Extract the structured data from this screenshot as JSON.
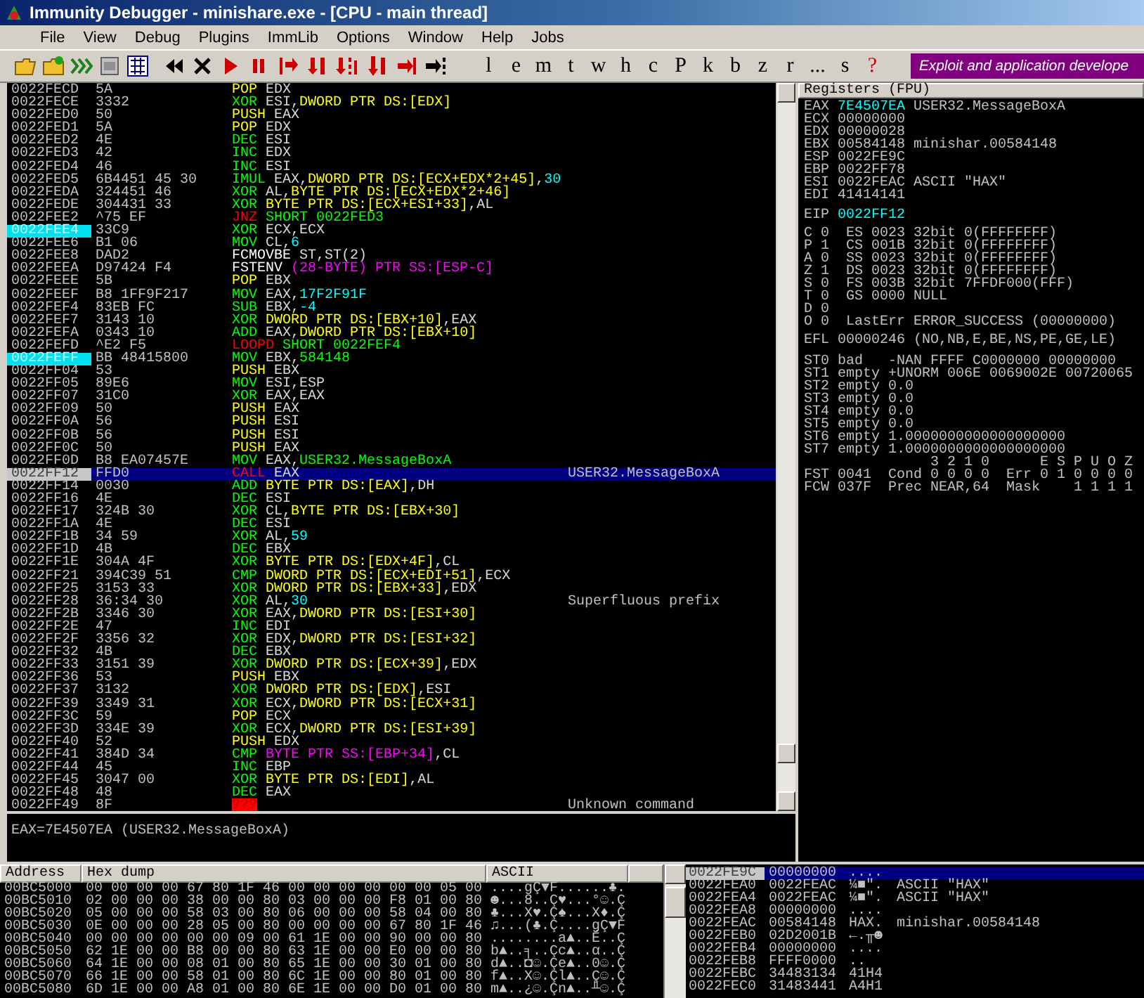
{
  "window": {
    "title": "Immunity Debugger - minishare.exe - [CPU - main thread]"
  },
  "menu": [
    "File",
    "View",
    "Debug",
    "Plugins",
    "ImmLib",
    "Options",
    "Window",
    "Help",
    "Jobs"
  ],
  "toolbar": {
    "buttons": [
      {
        "label": "l",
        "kind": "letter"
      },
      {
        "label": "e",
        "kind": "letter"
      },
      {
        "label": "m",
        "kind": "letter"
      },
      {
        "label": "t",
        "kind": "letter"
      },
      {
        "label": "w",
        "kind": "letter"
      },
      {
        "label": "h",
        "kind": "letter"
      },
      {
        "label": "c",
        "kind": "letter"
      },
      {
        "label": "P",
        "kind": "letter"
      },
      {
        "label": "k",
        "kind": "letter"
      },
      {
        "label": "b",
        "kind": "letter"
      },
      {
        "label": "z",
        "kind": "letter"
      },
      {
        "label": "r",
        "kind": "letter"
      },
      {
        "label": "...",
        "kind": "letter"
      },
      {
        "label": "s",
        "kind": "letter"
      },
      {
        "label": "?",
        "kind": "help"
      }
    ],
    "banner": "Exploit and application develope"
  },
  "disasm": {
    "rows": [
      {
        "address": "0022FECD",
        "hex": "5A",
        "mnemonic": "POP",
        "kind": "stack",
        "ops": [
          {
            "kind": "reg",
            "text": "EDX"
          }
        ],
        "selected": false,
        "jump_target": false
      },
      {
        "address": "0022FECE",
        "hex": "3332",
        "mnemonic": "XOR",
        "kind": "op",
        "ops": [
          {
            "kind": "reg",
            "text": "ESI,"
          },
          {
            "kind": "mem",
            "text": "DWORD PTR DS:[EDX]"
          }
        ],
        "selected": false,
        "jump_target": false
      },
      {
        "address": "0022FED0",
        "hex": "50",
        "mnemonic": "PUSH",
        "kind": "stack",
        "ops": [
          {
            "kind": "reg",
            "text": "EAX"
          }
        ],
        "selected": false,
        "jump_target": false
      },
      {
        "address": "0022FED1",
        "hex": "5A",
        "mnemonic": "POP",
        "kind": "stack",
        "ops": [
          {
            "kind": "reg",
            "text": "EDX"
          }
        ],
        "selected": false,
        "jump_target": false
      },
      {
        "address": "0022FED2",
        "hex": "4E",
        "mnemonic": "DEC",
        "kind": "op",
        "ops": [
          {
            "kind": "reg",
            "text": "ESI"
          }
        ],
        "selected": false,
        "jump_target": false
      },
      {
        "address": "0022FED3",
        "hex": "42",
        "mnemonic": "INC",
        "kind": "op",
        "ops": [
          {
            "kind": "reg",
            "text": "EDX"
          }
        ],
        "selected": false,
        "jump_target": false
      },
      {
        "address": "0022FED4",
        "hex": "46",
        "mnemonic": "INC",
        "kind": "op",
        "ops": [
          {
            "kind": "reg",
            "text": "ESI"
          }
        ],
        "selected": false,
        "jump_target": false
      },
      {
        "address": "0022FED5",
        "hex": "6B4451 45 30",
        "mnemonic": "IMUL",
        "kind": "op",
        "ops": [
          {
            "kind": "reg",
            "text": "EAX,"
          },
          {
            "kind": "mem",
            "text": "DWORD PTR DS:[ECX+EDX*2+45]"
          },
          {
            "kind": "reg",
            "text": ","
          },
          {
            "kind": "const",
            "text": "30"
          }
        ],
        "selected": false,
        "jump_target": false
      },
      {
        "address": "0022FEDA",
        "hex": "324451 46",
        "mnemonic": "XOR",
        "kind": "op",
        "ops": [
          {
            "kind": "reg",
            "text": "AL,"
          },
          {
            "kind": "mem",
            "text": "BYTE PTR DS:[ECX+EDX*2+46]"
          }
        ],
        "selected": false,
        "jump_target": false
      },
      {
        "address": "0022FEDE",
        "hex": "304431 33",
        "mnemonic": "XOR",
        "kind": "op",
        "ops": [
          {
            "kind": "mem",
            "text": "BYTE PTR DS:[ECX+ESI+33]"
          },
          {
            "kind": "reg",
            "text": ",AL"
          }
        ],
        "selected": false,
        "jump_target": false
      },
      {
        "address": "0022FEE2",
        "hex": "^75 EF",
        "mnemonic": "JNZ",
        "kind": "jump",
        "ops": [
          {
            "kind": "target",
            "text": "SHORT 0022FED3"
          }
        ],
        "selected": false,
        "jump_target": false
      },
      {
        "address": "0022FEE4",
        "hex": "33C9",
        "mnemonic": "XOR",
        "kind": "op",
        "ops": [
          {
            "kind": "reg",
            "text": "ECX,ECX"
          }
        ],
        "selected": false,
        "jump_target": true
      },
      {
        "address": "0022FEE6",
        "hex": "B1 06",
        "mnemonic": "MOV",
        "kind": "op",
        "ops": [
          {
            "kind": "reg",
            "text": "CL,"
          },
          {
            "kind": "const",
            "text": "6"
          }
        ],
        "selected": false,
        "jump_target": false
      },
      {
        "address": "0022FEE8",
        "hex": "DAD2",
        "mnemonic": "FCMOVBE",
        "kind": "fpu",
        "ops": [
          {
            "kind": "reg",
            "text": "ST,ST(2)"
          }
        ],
        "selected": false,
        "jump_target": false
      },
      {
        "address": "0022FEEA",
        "hex": "D97424 F4",
        "mnemonic": "FSTENV",
        "kind": "fpu",
        "ops": [
          {
            "kind": "ss",
            "text": "(28-BYTE) PTR SS:[ESP-C]"
          }
        ],
        "selected": false,
        "jump_target": false
      },
      {
        "address": "0022FEEE",
        "hex": "5B",
        "mnemonic": "POP",
        "kind": "stack",
        "ops": [
          {
            "kind": "reg",
            "text": "EBX"
          }
        ],
        "selected": false,
        "jump_target": false
      },
      {
        "address": "0022FEEF",
        "hex": "B8 1FF9F217",
        "mnemonic": "MOV",
        "kind": "op",
        "ops": [
          {
            "kind": "reg",
            "text": "EAX,"
          },
          {
            "kind": "const",
            "text": "17F2F91F"
          }
        ],
        "selected": false,
        "jump_target": false
      },
      {
        "address": "0022FEF4",
        "hex": "83EB FC",
        "mnemonic": "SUB",
        "kind": "op",
        "ops": [
          {
            "kind": "reg",
            "text": "EBX,"
          },
          {
            "kind": "const",
            "text": "-4"
          }
        ],
        "selected": false,
        "jump_target": false
      },
      {
        "address": "0022FEF7",
        "hex": "3143 10",
        "mnemonic": "XOR",
        "kind": "op",
        "ops": [
          {
            "kind": "mem",
            "text": "DWORD PTR DS:[EBX+10]"
          },
          {
            "kind": "reg",
            "text": ",EAX"
          }
        ],
        "selected": false,
        "jump_target": false
      },
      {
        "address": "0022FEFA",
        "hex": "0343 10",
        "mnemonic": "ADD",
        "kind": "op",
        "ops": [
          {
            "kind": "reg",
            "text": "EAX,"
          },
          {
            "kind": "mem",
            "text": "DWORD PTR DS:[EBX+10]"
          }
        ],
        "selected": false,
        "jump_target": false
      },
      {
        "address": "0022FEFD",
        "hex": "^E2 F5",
        "mnemonic": "LOOPD",
        "kind": "jump",
        "ops": [
          {
            "kind": "target",
            "text": "SHORT 0022FEF4"
          }
        ],
        "selected": false,
        "jump_target": false
      },
      {
        "address": "0022FEFF",
        "hex": "BB 48415800",
        "mnemonic": "MOV",
        "kind": "op",
        "ops": [
          {
            "kind": "reg",
            "text": "EBX,"
          },
          {
            "kind": "target",
            "text": "584148"
          }
        ],
        "selected": false,
        "jump_target": true
      },
      {
        "address": "0022FF04",
        "hex": "53",
        "mnemonic": "PUSH",
        "kind": "stack",
        "ops": [
          {
            "kind": "reg",
            "text": "EBX"
          }
        ],
        "selected": false,
        "jump_target": false
      },
      {
        "address": "0022FF05",
        "hex": "89E6",
        "mnemonic": "MOV",
        "kind": "op",
        "ops": [
          {
            "kind": "reg",
            "text": "ESI,ESP"
          }
        ],
        "selected": false,
        "jump_target": false
      },
      {
        "address": "0022FF07",
        "hex": "31C0",
        "mnemonic": "XOR",
        "kind": "op",
        "ops": [
          {
            "kind": "reg",
            "text": "EAX,EAX"
          }
        ],
        "selected": false,
        "jump_target": false
      },
      {
        "address": "0022FF09",
        "hex": "50",
        "mnemonic": "PUSH",
        "kind": "stack",
        "ops": [
          {
            "kind": "reg",
            "text": "EAX"
          }
        ],
        "selected": false,
        "jump_target": false
      },
      {
        "address": "0022FF0A",
        "hex": "56",
        "mnemonic": "PUSH",
        "kind": "stack",
        "ops": [
          {
            "kind": "reg",
            "text": "ESI"
          }
        ],
        "selected": false,
        "jump_target": false
      },
      {
        "address": "0022FF0B",
        "hex": "56",
        "mnemonic": "PUSH",
        "kind": "stack",
        "ops": [
          {
            "kind": "reg",
            "text": "ESI"
          }
        ],
        "selected": false,
        "jump_target": false
      },
      {
        "address": "0022FF0C",
        "hex": "50",
        "mnemonic": "PUSH",
        "kind": "stack",
        "ops": [
          {
            "kind": "reg",
            "text": "EAX"
          }
        ],
        "selected": false,
        "jump_target": false
      },
      {
        "address": "0022FF0D",
        "hex": "B8 EA07457E",
        "mnemonic": "MOV",
        "kind": "op",
        "ops": [
          {
            "kind": "reg",
            "text": "EAX,"
          },
          {
            "kind": "target",
            "text": "USER32.MessageBoxA"
          }
        ],
        "selected": false,
        "jump_target": false
      },
      {
        "address": "0022FF12",
        "hex": "FFD0",
        "mnemonic": "CALL",
        "kind": "jump",
        "ops": [
          {
            "kind": "reg",
            "text": "EAX"
          }
        ],
        "comment": "USER32.MessageBoxA",
        "selected": true,
        "jump_target": false
      },
      {
        "address": "0022FF14",
        "hex": "0030",
        "mnemonic": "ADD",
        "kind": "op",
        "ops": [
          {
            "kind": "mem",
            "text": "BYTE PTR DS:[EAX]"
          },
          {
            "kind": "reg",
            "text": ",DH"
          }
        ],
        "selected": false,
        "jump_target": false
      },
      {
        "address": "0022FF16",
        "hex": "4E",
        "mnemonic": "DEC",
        "kind": "op",
        "ops": [
          {
            "kind": "reg",
            "text": "ESI"
          }
        ],
        "selected": false,
        "jump_target": false
      },
      {
        "address": "0022FF17",
        "hex": "324B 30",
        "mnemonic": "XOR",
        "kind": "op",
        "ops": [
          {
            "kind": "reg",
            "text": "CL,"
          },
          {
            "kind": "mem",
            "text": "BYTE PTR DS:[EBX+30]"
          }
        ],
        "selected": false,
        "jump_target": false
      },
      {
        "address": "0022FF1A",
        "hex": "4E",
        "mnemonic": "DEC",
        "kind": "op",
        "ops": [
          {
            "kind": "reg",
            "text": "ESI"
          }
        ],
        "selected": false,
        "jump_target": false
      },
      {
        "address": "0022FF1B",
        "hex": "34 59",
        "mnemonic": "XOR",
        "kind": "op",
        "ops": [
          {
            "kind": "reg",
            "text": "AL,"
          },
          {
            "kind": "const",
            "text": "59"
          }
        ],
        "selected": false,
        "jump_target": false
      },
      {
        "address": "0022FF1D",
        "hex": "4B",
        "mnemonic": "DEC",
        "kind": "op",
        "ops": [
          {
            "kind": "reg",
            "text": "EBX"
          }
        ],
        "selected": false,
        "jump_target": false
      },
      {
        "address": "0022FF1E",
        "hex": "304A 4F",
        "mnemonic": "XOR",
        "kind": "op",
        "ops": [
          {
            "kind": "mem",
            "text": "BYTE PTR DS:[EDX+4F]"
          },
          {
            "kind": "reg",
            "text": ",CL"
          }
        ],
        "selected": false,
        "jump_target": false
      },
      {
        "address": "0022FF21",
        "hex": "394C39 51",
        "mnemonic": "CMP",
        "kind": "op",
        "ops": [
          {
            "kind": "mem",
            "text": "DWORD PTR DS:[ECX+EDI+51]"
          },
          {
            "kind": "reg",
            "text": ",ECX"
          }
        ],
        "selected": false,
        "jump_target": false
      },
      {
        "address": "0022FF25",
        "hex": "3153 33",
        "mnemonic": "XOR",
        "kind": "op",
        "ops": [
          {
            "kind": "mem",
            "text": "DWORD PTR DS:[EBX+33]"
          },
          {
            "kind": "reg",
            "text": ",EDX"
          }
        ],
        "selected": false,
        "jump_target": false
      },
      {
        "address": "0022FF28",
        "hex": "36:34 30",
        "mnemonic": "XOR",
        "kind": "op",
        "ops": [
          {
            "kind": "reg",
            "text": "AL,"
          },
          {
            "kind": "const",
            "text": "30"
          }
        ],
        "comment": "Superfluous prefix",
        "selected": false,
        "jump_target": false
      },
      {
        "address": "0022FF2B",
        "hex": "3346 30",
        "mnemonic": "XOR",
        "kind": "op",
        "ops": [
          {
            "kind": "reg",
            "text": "EAX,"
          },
          {
            "kind": "mem",
            "text": "DWORD PTR DS:[ESI+30]"
          }
        ],
        "selected": false,
        "jump_target": false
      },
      {
        "address": "0022FF2E",
        "hex": "47",
        "mnemonic": "INC",
        "kind": "op",
        "ops": [
          {
            "kind": "reg",
            "text": "EDI"
          }
        ],
        "selected": false,
        "jump_target": false
      },
      {
        "address": "0022FF2F",
        "hex": "3356 32",
        "mnemonic": "XOR",
        "kind": "op",
        "ops": [
          {
            "kind": "reg",
            "text": "EDX,"
          },
          {
            "kind": "mem",
            "text": "DWORD PTR DS:[ESI+32]"
          }
        ],
        "selected": false,
        "jump_target": false
      },
      {
        "address": "0022FF32",
        "hex": "4B",
        "mnemonic": "DEC",
        "kind": "op",
        "ops": [
          {
            "kind": "reg",
            "text": "EBX"
          }
        ],
        "selected": false,
        "jump_target": false
      },
      {
        "address": "0022FF33",
        "hex": "3151 39",
        "mnemonic": "XOR",
        "kind": "op",
        "ops": [
          {
            "kind": "mem",
            "text": "DWORD PTR DS:[ECX+39]"
          },
          {
            "kind": "reg",
            "text": ",EDX"
          }
        ],
        "selected": false,
        "jump_target": false
      },
      {
        "address": "0022FF36",
        "hex": "53",
        "mnemonic": "PUSH",
        "kind": "stack",
        "ops": [
          {
            "kind": "reg",
            "text": "EBX"
          }
        ],
        "selected": false,
        "jump_target": false
      },
      {
        "address": "0022FF37",
        "hex": "3132",
        "mnemonic": "XOR",
        "kind": "op",
        "ops": [
          {
            "kind": "mem",
            "text": "DWORD PTR DS:[EDX]"
          },
          {
            "kind": "reg",
            "text": ",ESI"
          }
        ],
        "selected": false,
        "jump_target": false
      },
      {
        "address": "0022FF39",
        "hex": "3349 31",
        "mnemonic": "XOR",
        "kind": "op",
        "ops": [
          {
            "kind": "reg",
            "text": "ECX,"
          },
          {
            "kind": "mem",
            "text": "DWORD PTR DS:[ECX+31]"
          }
        ],
        "selected": false,
        "jump_target": false
      },
      {
        "address": "0022FF3C",
        "hex": "59",
        "mnemonic": "POP",
        "kind": "stack",
        "ops": [
          {
            "kind": "reg",
            "text": "ECX"
          }
        ],
        "selected": false,
        "jump_target": false
      },
      {
        "address": "0022FF3D",
        "hex": "334E 39",
        "mnemonic": "XOR",
        "kind": "op",
        "ops": [
          {
            "kind": "reg",
            "text": "ECX,"
          },
          {
            "kind": "mem",
            "text": "DWORD PTR DS:[ESI+39]"
          }
        ],
        "selected": false,
        "jump_target": false
      },
      {
        "address": "0022FF40",
        "hex": "52",
        "mnemonic": "PUSH",
        "kind": "stack",
        "ops": [
          {
            "kind": "reg",
            "text": "EDX"
          }
        ],
        "selected": false,
        "jump_target": false
      },
      {
        "address": "0022FF41",
        "hex": "384D 34",
        "mnemonic": "CMP",
        "kind": "op",
        "ops": [
          {
            "kind": "ss",
            "text": "BYTE PTR SS:[EBP+34]"
          },
          {
            "kind": "reg",
            "text": ",CL"
          }
        ],
        "selected": false,
        "jump_target": false
      },
      {
        "address": "0022FF44",
        "hex": "45",
        "mnemonic": "INC",
        "kind": "op",
        "ops": [
          {
            "kind": "reg",
            "text": "EBP"
          }
        ],
        "selected": false,
        "jump_target": false
      },
      {
        "address": "0022FF45",
        "hex": "3047 00",
        "mnemonic": "XOR",
        "kind": "op",
        "ops": [
          {
            "kind": "mem",
            "text": "BYTE PTR DS:[EDI]"
          },
          {
            "kind": "reg",
            "text": ",AL"
          }
        ],
        "selected": false,
        "jump_target": false
      },
      {
        "address": "0022FF48",
        "hex": "48",
        "mnemonic": "DEC",
        "kind": "op",
        "ops": [
          {
            "kind": "reg",
            "text": "EAX"
          }
        ],
        "selected": false,
        "jump_target": false
      },
      {
        "address": "0022FF49",
        "hex": "8F",
        "mnemonic": "???",
        "kind": "bad",
        "ops": [],
        "comment": "Unknown command",
        "selected": false,
        "jump_target": false
      }
    ],
    "info": "EAX=7E4507EA (USER32.MessageBoxA)"
  },
  "registers": {
    "title": "Registers (FPU)",
    "general": [
      {
        "name": "EAX",
        "value": "7E4507EA",
        "comment": "USER32.MessageBoxA",
        "changed": true
      },
      {
        "name": "ECX",
        "value": "00000000",
        "changed": false
      },
      {
        "name": "EDX",
        "value": "00000028",
        "changed": false
      },
      {
        "name": "EBX",
        "value": "00584148",
        "comment": "minishar.00584148",
        "changed": false
      },
      {
        "name": "ESP",
        "value": "0022FE9C",
        "changed": false
      },
      {
        "name": "EBP",
        "value": "0022FF78",
        "changed": false
      },
      {
        "name": "ESI",
        "value": "0022FEAC",
        "comment": "ASCII \"HAX\"",
        "changed": false
      },
      {
        "name": "EDI",
        "value": "41414141",
        "changed": false
      }
    ],
    "eip": {
      "name": "EIP",
      "value": "0022FF12",
      "changed": true
    },
    "flags": [
      {
        "flag": "C",
        "value": "0",
        "segment": "ES 0023 32bit 0(FFFFFFFF)"
      },
      {
        "flag": "P",
        "value": "1",
        "segment": "CS 001B 32bit 0(FFFFFFFF)"
      },
      {
        "flag": "A",
        "value": "0",
        "segment": "SS 0023 32bit 0(FFFFFFFF)"
      },
      {
        "flag": "Z",
        "value": "1",
        "segment": "DS 0023 32bit 0(FFFFFFFF)"
      },
      {
        "flag": "S",
        "value": "0",
        "segment": "FS 003B 32bit 7FFDF000(FFF)"
      },
      {
        "flag": "T",
        "value": "0",
        "segment": "GS 0000 NULL"
      },
      {
        "flag": "D",
        "value": "0"
      },
      {
        "flag": "O",
        "value": "0",
        "segment": "LastErr ERROR_SUCCESS (00000000)"
      }
    ],
    "efl": {
      "name": "EFL",
      "value": "00000246",
      "decoded": "(NO,NB,E,BE,NS,PE,GE,LE)"
    },
    "fpu": [
      {
        "name": "ST0",
        "tag": "bad",
        "value": "-NAN FFFF C0000000 00000000"
      },
      {
        "name": "ST1",
        "tag": "empty",
        "value": "+UNORM 006E 0069002E 00720065"
      },
      {
        "name": "ST2",
        "tag": "empty",
        "value": "0.0"
      },
      {
        "name": "ST3",
        "tag": "empty",
        "value": "0.0"
      },
      {
        "name": "ST4",
        "tag": "empty",
        "value": "0.0"
      },
      {
        "name": "ST5",
        "tag": "empty",
        "value": "0.0"
      },
      {
        "name": "ST6",
        "tag": "empty",
        "value": "1.0000000000000000000"
      },
      {
        "name": "ST7",
        "tag": "empty",
        "value": "1.0000000000000000000"
      }
    ],
    "fpu_status": [
      "               3 2 1 0      E S P U O Z",
      "FST 0041  Cond 0 0 0 0  Err 0 1 0 0 0 0",
      "FCW 037F  Prec NEAR,64  Mask    1 1 1 1"
    ]
  },
  "dump": {
    "columns": [
      "Address",
      "Hex dump",
      "ASCII"
    ],
    "rows": [
      {
        "address": "00BC5000",
        "hex": "00 00 00 00 67 80 1F 46 00 00 00 00 00 00 05 00",
        "ascii": "....gÇ▼F......♣."
      },
      {
        "address": "00BC5010",
        "hex": "02 00 00 00 38 00 00 80 03 00 00 00 F8 01 00 80",
        "ascii": "☻...8..Ç♥...°☺.Ç"
      },
      {
        "address": "00BC5020",
        "hex": "05 00 00 00 58 03 00 80 06 00 00 00 58 04 00 80",
        "ascii": "♣...X♥.Ç♠...X♦.Ç"
      },
      {
        "address": "00BC5030",
        "hex": "0E 00 00 00 28 05 00 80 00 00 00 00 67 80 1F 46",
        "ascii": "♫...(♣.Ç....gÇ▼F"
      },
      {
        "address": "00BC5040",
        "hex": "00 00 00 00 00 00 09 00 61 1E 00 00 90 00 00 80",
        "ascii": "........a▲..É..Ç"
      },
      {
        "address": "00BC5050",
        "hex": "62 1E 00 00 B8 00 00 80 63 1E 00 00 E0 00 00 80",
        "ascii": "b▲..╕..Çc▲..α..Ç"
      },
      {
        "address": "00BC5060",
        "hex": "64 1E 00 00 08 01 00 80 65 1E 00 00 30 01 00 80",
        "ascii": "d▲..◘☺.Çe▲..0☺.Ç"
      },
      {
        "address": "00BC5070",
        "hex": "66 1E 00 00 58 01 00 80 6C 1E 00 00 80 01 00 80",
        "ascii": "f▲..X☺.Çl▲..Ç☺.Ç"
      },
      {
        "address": "00BC5080",
        "hex": "6D 1E 00 00 A8 01 00 80 6E 1E 00 00 D0 01 00 80",
        "ascii": "m▲..¿☺.Çn▲..╨☺.Ç"
      }
    ]
  },
  "stack": {
    "rows": [
      {
        "address": "0022FE9C",
        "value": "00000000",
        "ascii": "....",
        "selected": true
      },
      {
        "address": "0022FEA0",
        "value": "0022FEAC",
        "ascii": "¼■\".",
        "comment": "ASCII \"HAX\"",
        "selected": false
      },
      {
        "address": "0022FEA4",
        "value": "0022FEAC",
        "ascii": "¼■\".",
        "comment": "ASCII \"HAX\"",
        "selected": false
      },
      {
        "address": "0022FEA8",
        "value": "00000000",
        "ascii": "....",
        "selected": false
      },
      {
        "address": "0022FEAC",
        "value": "00584148",
        "ascii": "HAX.",
        "comment": "minishar.00584148",
        "selected": false
      },
      {
        "address": "0022FEB0",
        "value": "02D2001B",
        "ascii": "←.╥☻",
        "selected": false
      },
      {
        "address": "0022FEB4",
        "value": "00000000",
        "ascii": "....",
        "selected": false
      },
      {
        "address": "0022FEB8",
        "value": "FFFF0000",
        "ascii": "..",
        "selected": false
      },
      {
        "address": "0022FEBC",
        "value": "34483134",
        "ascii": "41H4",
        "selected": false
      },
      {
        "address": "0022FEC0",
        "value": "31483441",
        "ascii": "A4H1",
        "selected": false
      }
    ]
  }
}
